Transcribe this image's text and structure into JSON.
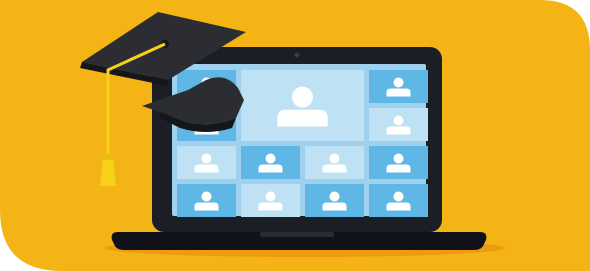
{
  "illustration": {
    "subject": "laptop-video-call-graduation",
    "colors": {
      "background": "#F5B416",
      "floor_shadow": "#EE9A12",
      "laptop_body": "#1C1E26",
      "screen_tile_light": "#BFE1F4",
      "screen_tile_dark": "#5FB7E6",
      "person": "#FFFFFF",
      "cap": "#2B2D33",
      "cap_shadow": "#15161A",
      "tassel": "#F7D117"
    },
    "icons": [
      "graduation-cap-icon",
      "person-avatar-icon",
      "webcam-icon",
      "laptop-icon"
    ],
    "video_tiles": [
      {
        "row": 0,
        "col": 0,
        "tone": "dark"
      },
      {
        "row": 0,
        "col": 3,
        "tone": "dark"
      },
      {
        "row": 1,
        "col": 0,
        "tone": "dark"
      },
      {
        "row": 1,
        "col": 3,
        "tone": "light"
      },
      {
        "row": 2,
        "col": 0,
        "tone": "light"
      },
      {
        "row": 2,
        "col": 1,
        "tone": "dark"
      },
      {
        "row": 2,
        "col": 2,
        "tone": "light"
      },
      {
        "row": 2,
        "col": 3,
        "tone": "dark"
      },
      {
        "row": 3,
        "col": 0,
        "tone": "dark"
      },
      {
        "row": 3,
        "col": 1,
        "tone": "light"
      },
      {
        "row": 3,
        "col": 2,
        "tone": "dark"
      },
      {
        "row": 3,
        "col": 3,
        "tone": "dark"
      }
    ],
    "featured_tile": {
      "tone": "light"
    }
  }
}
